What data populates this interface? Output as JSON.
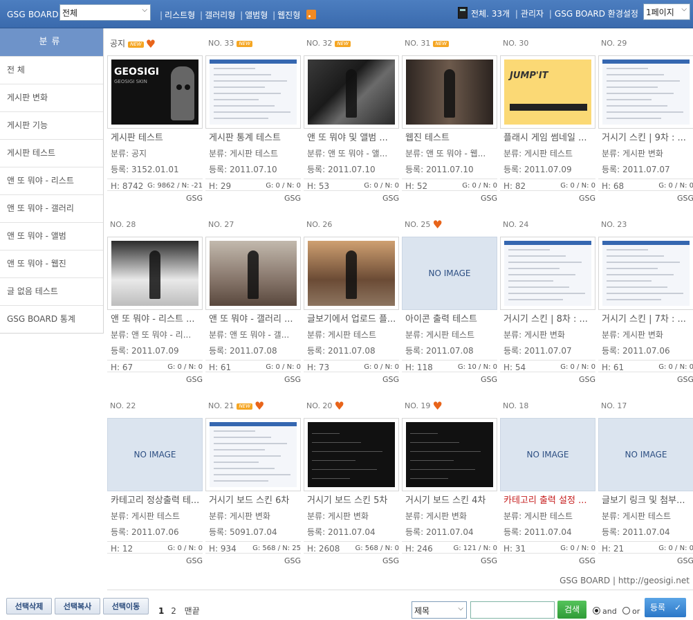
{
  "topbar": {
    "brand": "GSG BOARD",
    "category_select": "전체",
    "view_links": [
      "리스트형",
      "갤러리형",
      "앨범형",
      "웹진형"
    ],
    "total": "전체. 33개",
    "admin": "관리자",
    "settings": "GSG BOARD 환경설정",
    "page_select": "1페이지"
  },
  "sidebar": {
    "title": "분류",
    "items": [
      "전 체",
      "게시판 변화",
      "게시판 기능",
      "게시판 테스트",
      "앤 또 뭐야 - 리스트",
      "앤 또 뭐야 - 갤러리",
      "앤 또 뭐야 - 앨범",
      "앤 또 뭐야 - 웹진",
      "글 없음 테스트",
      "GSG BOARD 통계"
    ]
  },
  "no_image_label": "NO IMAGE",
  "cards": [
    {
      "no": "공지",
      "new": true,
      "heart": true,
      "thumb": "gosigi",
      "title": "게시판 테스트",
      "cat": "분류: 공지",
      "date": "등록: 3152.01.01",
      "hits": "H: 8742",
      "gn": "G: 9862 / N: -21",
      "author": "GSG"
    },
    {
      "no": "NO. 33",
      "new": true,
      "heart": false,
      "thumb": "shot",
      "title": "게시판 통계 테스트",
      "cat": "분류: 게시판 테스트",
      "date": "등록: 2011.07.10",
      "hits": "H: 29",
      "gn": "G: 0 / N: 0",
      "author": "GSG"
    },
    {
      "no": "NO. 32",
      "new": true,
      "heart": false,
      "thumb": "photo1",
      "title": "앤 또 뭐야 및 앨범 ...",
      "cat": "분류: 앤 또 뭐야 - 앨...",
      "date": "등록: 2011.07.10",
      "hits": "H: 53",
      "gn": "G: 0 / N: 0",
      "author": "GSG"
    },
    {
      "no": "NO. 31",
      "new": true,
      "heart": false,
      "thumb": "photo2",
      "title": "웹진 테스트",
      "cat": "분류: 앤 또 뭐야 - 웹...",
      "date": "등록: 2011.07.10",
      "hits": "H: 52",
      "gn": "G: 0 / N: 0",
      "author": "GSG"
    },
    {
      "no": "NO. 30",
      "new": false,
      "heart": false,
      "thumb": "game",
      "title": "플래시 게임 썸네일 ...",
      "cat": "분류: 게시판 테스트",
      "date": "등록: 2011.07.09",
      "hits": "H: 82",
      "gn": "G: 0 / N: 0",
      "author": "GSG"
    },
    {
      "no": "NO. 29",
      "new": false,
      "heart": false,
      "thumb": "shot",
      "title": "거시기 스킨 | 9차 : ...",
      "cat": "분류: 게시판 변화",
      "date": "등록: 2011.07.07",
      "hits": "H: 68",
      "gn": "G: 0 / N: 0",
      "author": "GSG"
    },
    {
      "no": "NO. 28",
      "new": false,
      "heart": false,
      "thumb": "photo3",
      "title": "앤 또 뭐야 - 리스트 ...",
      "cat": "분류: 앤 또 뭐야 - 리...",
      "date": "등록: 2011.07.09",
      "hits": "H: 67",
      "gn": "G: 0 / N: 0",
      "author": "GSG"
    },
    {
      "no": "NO. 27",
      "new": false,
      "heart": false,
      "thumb": "photo4",
      "title": "앤 또 뭐야 - 갤러리 ...",
      "cat": "분류: 앤 또 뭐야 - 갤...",
      "date": "등록: 2011.07.08",
      "hits": "H: 61",
      "gn": "G: 0 / N: 0",
      "author": "GSG"
    },
    {
      "no": "NO. 26",
      "new": false,
      "heart": false,
      "thumb": "photo5",
      "title": "글보기에서 업로드 플...",
      "cat": "분류: 게시판 테스트",
      "date": "등록: 2011.07.08",
      "hits": "H: 73",
      "gn": "G: 0 / N: 0",
      "author": "GSG"
    },
    {
      "no": "NO. 25",
      "new": false,
      "heart": true,
      "thumb": "none",
      "title": "아이콘 출력 테스트",
      "cat": "분류: 게시판 테스트",
      "date": "등록: 2011.07.08",
      "hits": "H: 118",
      "gn": "G: 10 / N: 0",
      "author": "GSG"
    },
    {
      "no": "NO. 24",
      "new": false,
      "heart": false,
      "thumb": "shot",
      "title": "거시기 스킨 | 8차 : ...",
      "cat": "분류: 게시판 변화",
      "date": "등록: 2011.07.07",
      "hits": "H: 54",
      "gn": "G: 0 / N: 0",
      "author": "GSG"
    },
    {
      "no": "NO. 23",
      "new": false,
      "heart": false,
      "thumb": "shot",
      "title": "거시기 스킨 | 7차 : ...",
      "cat": "분류: 게시판 변화",
      "date": "등록: 2011.07.06",
      "hits": "H: 61",
      "gn": "G: 0 / N: 0",
      "author": "GSG"
    },
    {
      "no": "NO. 22",
      "new": false,
      "heart": false,
      "thumb": "none",
      "title": "카테고리 정상출력 테...",
      "cat": "분류: 게시판 테스트",
      "date": "등록: 2011.07.06",
      "hits": "H: 12",
      "gn": "G: 0 / N: 0",
      "author": "GSG"
    },
    {
      "no": "NO. 21",
      "new": true,
      "heart": true,
      "thumb": "shot",
      "title": "거시기 보드 스킨 6차",
      "cat": "분류: 게시판 변화",
      "date": "등록: 5091.07.04",
      "hits": "H: 934",
      "gn": "G: 568 / N: 25",
      "author": "GSG"
    },
    {
      "no": "NO. 20",
      "new": false,
      "heart": true,
      "thumb": "terminal",
      "title": "거시기 보드 스킨 5차",
      "cat": "분류: 게시판 변화",
      "date": "등록: 2011.07.04",
      "hits": "H: 2608",
      "gn": "G: 568 / N: 0",
      "author": "GSG"
    },
    {
      "no": "NO. 19",
      "new": false,
      "heart": true,
      "thumb": "terminal",
      "title": "거시기 보드 스킨 4차",
      "cat": "분류: 게시판 변화",
      "date": "등록: 2011.07.04",
      "hits": "H: 246",
      "gn": "G: 121 / N: 0",
      "author": "GSG"
    },
    {
      "no": "NO. 18",
      "new": false,
      "heart": false,
      "thumb": "none",
      "title": "카테고리 출력 설정 ...",
      "red": true,
      "cat": "분류: 게시판 테스트",
      "date": "등록: 2011.07.04",
      "hits": "H: 31",
      "gn": "G: 0 / N: 0",
      "author": "GSG"
    },
    {
      "no": "NO. 17",
      "new": false,
      "heart": false,
      "thumb": "none",
      "title": "글보기 링크 및 첨부...",
      "cat": "분류: 게시판 테스트",
      "date": "등록: 2011.07.04",
      "hits": "H: 21",
      "gn": "G: 0 / N: 0",
      "author": "GSG"
    }
  ],
  "footer": {
    "credit": "GSG BOARD | http://geosigi.net",
    "buttons": [
      "선택삭제",
      "선택복사",
      "선택이동"
    ],
    "pages": [
      "1",
      "2"
    ],
    "last_page": "맨끝",
    "search_field": "제목",
    "search_value": "",
    "search_button": "검색",
    "radio_and": "and",
    "radio_or": "or",
    "submit": "등록"
  }
}
